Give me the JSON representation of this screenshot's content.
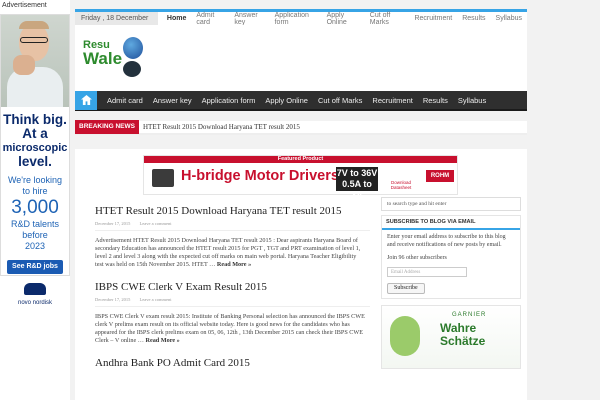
{
  "left_ad": {
    "label": "Advertisement",
    "headline_lines": [
      "Think big.",
      "At a",
      "microscopic",
      "level."
    ],
    "sub1_lines": [
      "We're looking",
      "to hire"
    ],
    "big_number": "3,000",
    "sub2_lines": [
      "R&D talents",
      "before",
      "2023"
    ],
    "cta": "See R&D jobs",
    "logo_text": "novo nordisk"
  },
  "topbar": {
    "date": "Friday , 18 December 2015",
    "links": [
      "Home",
      "Admit card",
      "Answer key",
      "Application form",
      "Apply Online",
      "Cut off Marks",
      "Recruitment",
      "Results",
      "Syllabus"
    ]
  },
  "logo": {
    "line1": "Resu",
    "line2": "Wale"
  },
  "mainnav": {
    "items": [
      "Admit card",
      "Answer key",
      "Application form",
      "Apply Online",
      "Cut off Marks",
      "Recruitment",
      "Results",
      "Syllabus"
    ]
  },
  "breaking": {
    "label": "BREAKING NEWS",
    "text": "HTET Result 2015 Download Haryana TET result 2015"
  },
  "banner": {
    "strip": "Featured Product",
    "title": "H-bridge Motor Drivers",
    "volt1": "7V to 36V",
    "volt2": "0.5A to 3A",
    "datasheet": "Download Datasheet",
    "brand": "ROHM"
  },
  "posts": [
    {
      "title": "HTET Result 2015 Download Haryana TET result 2015",
      "date": "December 17, 2015",
      "comments": "Leave a comment",
      "excerpt": "Advertisement HTET Result 2015 Download Haryana TET result 2015 : Dear aspirants Haryana Board of secondary Education has announced the HTET result 2015 for PGT , TGT and PRT examination of level 1, level 2 and level 3 along with the expected cut off marks on main web portal. Haryana Teacher Eligibility test was held on 15th November 2015. HTET …",
      "readmore": "Read More »"
    },
    {
      "title": "IBPS CWE Clerk V Exam Result 2015",
      "date": "December 17, 2015",
      "comments": "Leave a comment",
      "excerpt": "IBPS CWE Clerk V exam result 2015: Institute of Banking Personal selection has announced the IBPS CWE clerk V prelims exam result on its official website today. Here is good news for the candidates who has appeared for the IBPS clerk prelims exam on 05, 06, 12th , 13th December 2015 can check their IBPS CWE Clerk – V online …",
      "readmore": "Read More »"
    },
    {
      "title": "Andhra Bank PO Admit Card 2015"
    }
  ],
  "sidebar": {
    "search_placeholder": "to search type and hit enter",
    "widget_title": "SUBSCRIBE TO BLOG VIA EMAIL",
    "widget_text": "Enter your email address to subscribe to this blog and receive notifications of new posts by email.",
    "subscribers": "Join 96 other subscribers",
    "email_placeholder": "Email Address",
    "subscribe_label": "Subscribe",
    "ad_brand": "GARNIER",
    "ad_product_lines": [
      "Wahre",
      "Schätze"
    ]
  },
  "colors": {
    "accent": "#37a4e6",
    "breaking": "#c8102e",
    "nav_bg": "#2f2f2f"
  }
}
